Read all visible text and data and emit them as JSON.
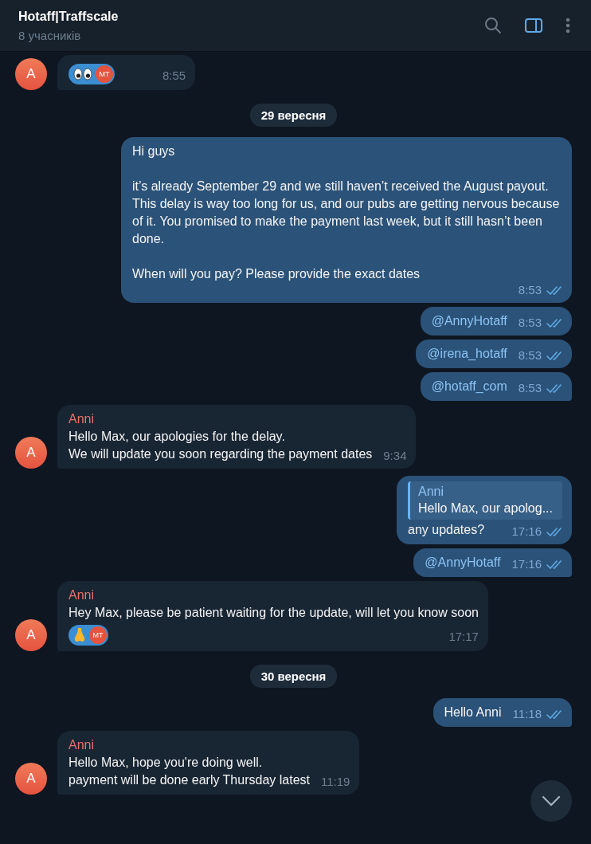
{
  "header": {
    "title": "Hotaff|Traffscale",
    "subtitle": "8 учасників",
    "sidebar_toggle_on": true
  },
  "messages": [
    {
      "kind": "in",
      "avatar": "A",
      "reaction": {
        "kind": "eyes",
        "initials": "MT"
      },
      "time": "8:55"
    },
    {
      "kind": "date",
      "text": "29 вересня"
    },
    {
      "kind": "out",
      "text": "Hi guys\n\nit’s already September 29 and we still haven’t received the August payout. This delay is way too long for us, and our pubs are getting nervous because of it. You promised to make the payment last week, but it still hasn’t been done.\n\nWhen will you pay? Please provide the exact dates",
      "time": "8:53",
      "read": true,
      "mention": false,
      "tail": false
    },
    {
      "kind": "out",
      "text": "@AnnyHotaff",
      "time": "8:53",
      "read": true,
      "mention": true,
      "tail": false
    },
    {
      "kind": "out",
      "text": "@irena_hotaff",
      "time": "8:53",
      "read": true,
      "mention": true,
      "tail": false
    },
    {
      "kind": "out",
      "text": "@hotaff_com",
      "time": "8:53",
      "read": true,
      "mention": true,
      "tail": true
    },
    {
      "kind": "in",
      "sender": "Anni",
      "avatar": "A",
      "text": "Hello Max, our apologies for the delay.\nWe will update you soon regarding the payment dates",
      "time": "9:34"
    },
    {
      "kind": "out",
      "reply": {
        "sender": "Anni",
        "text": "Hello Max, our apolog..."
      },
      "text": "any updates?",
      "time": "17:16",
      "read": true,
      "mention": false,
      "tail": false
    },
    {
      "kind": "out",
      "text": "@AnnyHotaff",
      "time": "17:16",
      "read": true,
      "mention": true,
      "tail": true
    },
    {
      "kind": "in",
      "sender": "Anni",
      "avatar": "A",
      "text": "Hey Max, please be patient waiting for the update, will let you know soon",
      "reaction": {
        "kind": "nose",
        "initials": "MT"
      },
      "time": "17:17"
    },
    {
      "kind": "date",
      "text": "30 вересня"
    },
    {
      "kind": "out",
      "text": "Hello Anni",
      "time": "11:18",
      "read": true,
      "mention": false,
      "tail": true
    },
    {
      "kind": "in",
      "sender": "Anni",
      "avatar": "A",
      "text": "Hello Max, hope you're doing well.\npayment will be done early Thursday latest",
      "time": "11:19"
    }
  ]
}
